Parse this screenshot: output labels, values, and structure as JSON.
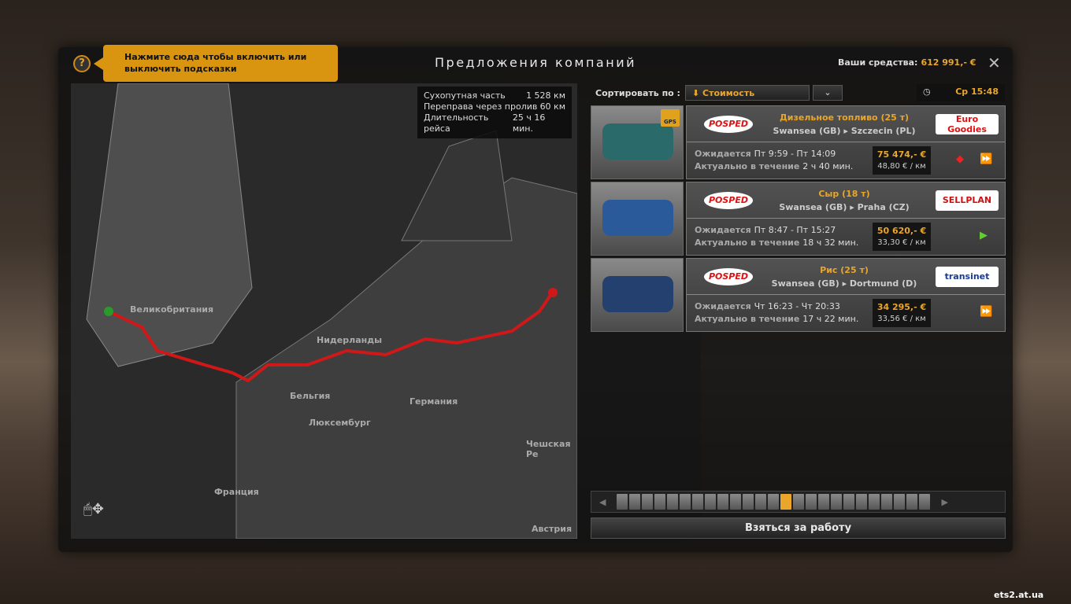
{
  "title": "Предложения компаний",
  "hint": "Нажмите сюда чтобы включить или выключить подсказки",
  "help_label": "?",
  "funds": {
    "label": "Ваши средства:",
    "value": "612 991,- €"
  },
  "close_label": "✕",
  "trip": {
    "rows": [
      {
        "l": "Сухопутная часть",
        "v": "1 528 км"
      },
      {
        "l": "Переправа через пролив",
        "v": "60 км"
      },
      {
        "l": "Длительность рейса",
        "v": "25 ч 16 мин."
      }
    ]
  },
  "map_labels": [
    "Великобритания",
    "Нидерланды",
    "Бельгия",
    "Люксембург",
    "Германия",
    "Франция",
    "Чешская Ре",
    "Австрия"
  ],
  "sort": {
    "label": "Сортировать по :",
    "value": "Стоимость"
  },
  "clock": "Ср 15:48",
  "jobs": [
    {
      "cargo": "Дизельное топливо (25 т)",
      "company": "POSPED",
      "route": "Swansea (GB) ▸ Szczecin (PL)",
      "expected_label": "Ожидается",
      "expected": "Пт 9:59 - Пт 14:09",
      "active_label": "Актуально в течение",
      "active": "2 ч 40 мин.",
      "price": "75 474,- €",
      "per_km": "48,80 € / км",
      "client": "Euro Goodies",
      "gps": "GPS",
      "tc": "#2a6a6a"
    },
    {
      "cargo": "Сыр (18 т)",
      "company": "POSPED",
      "route": "Swansea (GB) ▸ Praha (CZ)",
      "expected_label": "Ожидается",
      "expected": "Пт 8:47 - Пт 15:27",
      "active_label": "Актуально в течение",
      "active": "18 ч 32 мин.",
      "price": "50 620,- €",
      "per_km": "33,30 € / км",
      "client": "SELLPLAN",
      "tc": "#2a5a9a"
    },
    {
      "cargo": "Рис (25 т)",
      "company": "POSPED",
      "route": "Swansea (GB) ▸ Dortmund (D)",
      "expected_label": "Ожидается",
      "expected": "Чт 16:23 - Чт 20:33",
      "active_label": "Актуально в течение",
      "active": "17 ч 22 мин.",
      "price": "34 295,- €",
      "per_km": "33,56 € / км",
      "client": "transinet",
      "tc": "#23406e"
    }
  ],
  "take_label": "Взяться за работу",
  "watermark": "ets2.at.ua"
}
